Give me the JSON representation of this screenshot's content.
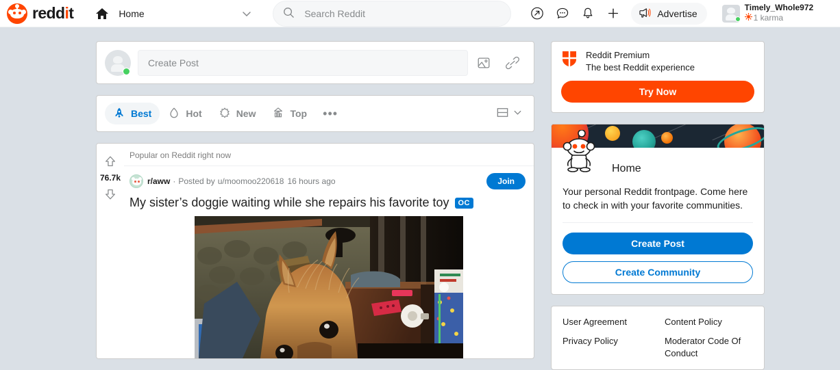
{
  "header": {
    "logo_text_1": "redd",
    "logo_text_2": "i",
    "logo_text_3": "t",
    "logo_icon": "reddit-snoo-logo",
    "home_label": "Home",
    "home_icon": "home-icon",
    "dropdown_icon": "chevron-down-icon",
    "search": {
      "placeholder": "Search Reddit",
      "value": "",
      "icon": "search-icon"
    },
    "icons": [
      {
        "name": "popular-icon",
        "glyph": "arrow-up-right-circle"
      },
      {
        "name": "chat-icon",
        "glyph": "speech-bubble"
      },
      {
        "name": "notifications-icon",
        "glyph": "bell"
      },
      {
        "name": "create-icon",
        "glyph": "plus"
      }
    ],
    "advertise_label": "Advertise",
    "advertise_icon": "megaphone-icon",
    "user": {
      "name": "Timely_Whole972",
      "karma": "1 karma",
      "karma_icon": "karma-sun-icon",
      "avatar_icon": "user-avatar-placeholder",
      "online": true
    }
  },
  "create_post": {
    "placeholder": "Create Post",
    "value": "",
    "avatar_icon": "user-avatar-placeholder",
    "image_icon": "image-icon",
    "link_icon": "link-icon"
  },
  "sortbar": {
    "items": [
      {
        "label": "Best",
        "icon": "rocket-icon",
        "active": true
      },
      {
        "label": "Hot",
        "icon": "flame-icon",
        "active": false
      },
      {
        "label": "New",
        "icon": "sparkle-icon",
        "active": false
      },
      {
        "label": "Top",
        "icon": "bar-chart-icon",
        "active": false
      }
    ],
    "more_label": "•••",
    "more_icon": "ellipsis-icon",
    "view_icon": "card-view-icon",
    "view_chevron": "chevron-down-icon"
  },
  "post": {
    "banner": "Popular on Reddit right now",
    "score": "76.7k",
    "upvote_icon": "upvote-arrow-icon",
    "downvote_icon": "downvote-arrow-icon",
    "subreddit": "r/aww",
    "subreddit_avatar": "aww-subreddit-avatar",
    "separator": "·",
    "posted_by_prefix": "Posted by",
    "author": "u/moomoo220618",
    "timestamp": "16 hours ago",
    "join_label": "Join",
    "title": "My sister’s doggie waiting while she repairs his favorite toy",
    "oc_badge": "OC",
    "image_alt": "yorkshire-terrier-peeking-over-table"
  },
  "sidebar": {
    "premium": {
      "title": "Reddit Premium",
      "subtitle": "The best Reddit experience",
      "icon": "reddit-premium-shield-icon",
      "cta": "Try Now",
      "cta_color": "#ff4500"
    },
    "home": {
      "banner_icon": "space-planets-banner",
      "snoo_icon": "snoo-mascot-icon",
      "title": "Home",
      "description": "Your personal Reddit frontpage. Come here to check in with your favorite communities.",
      "create_post": "Create Post",
      "create_community": "Create Community",
      "primary_color": "#0079d3"
    },
    "footer_links": [
      "User Agreement",
      "Content Policy",
      "Privacy Policy",
      "Moderator Code Of Conduct"
    ]
  },
  "colors": {
    "page_bg": "#dae0e6",
    "accent_orange": "#ff4500",
    "accent_blue": "#0079d3",
    "online_green": "#46d160",
    "muted_text": "#878a8c"
  }
}
